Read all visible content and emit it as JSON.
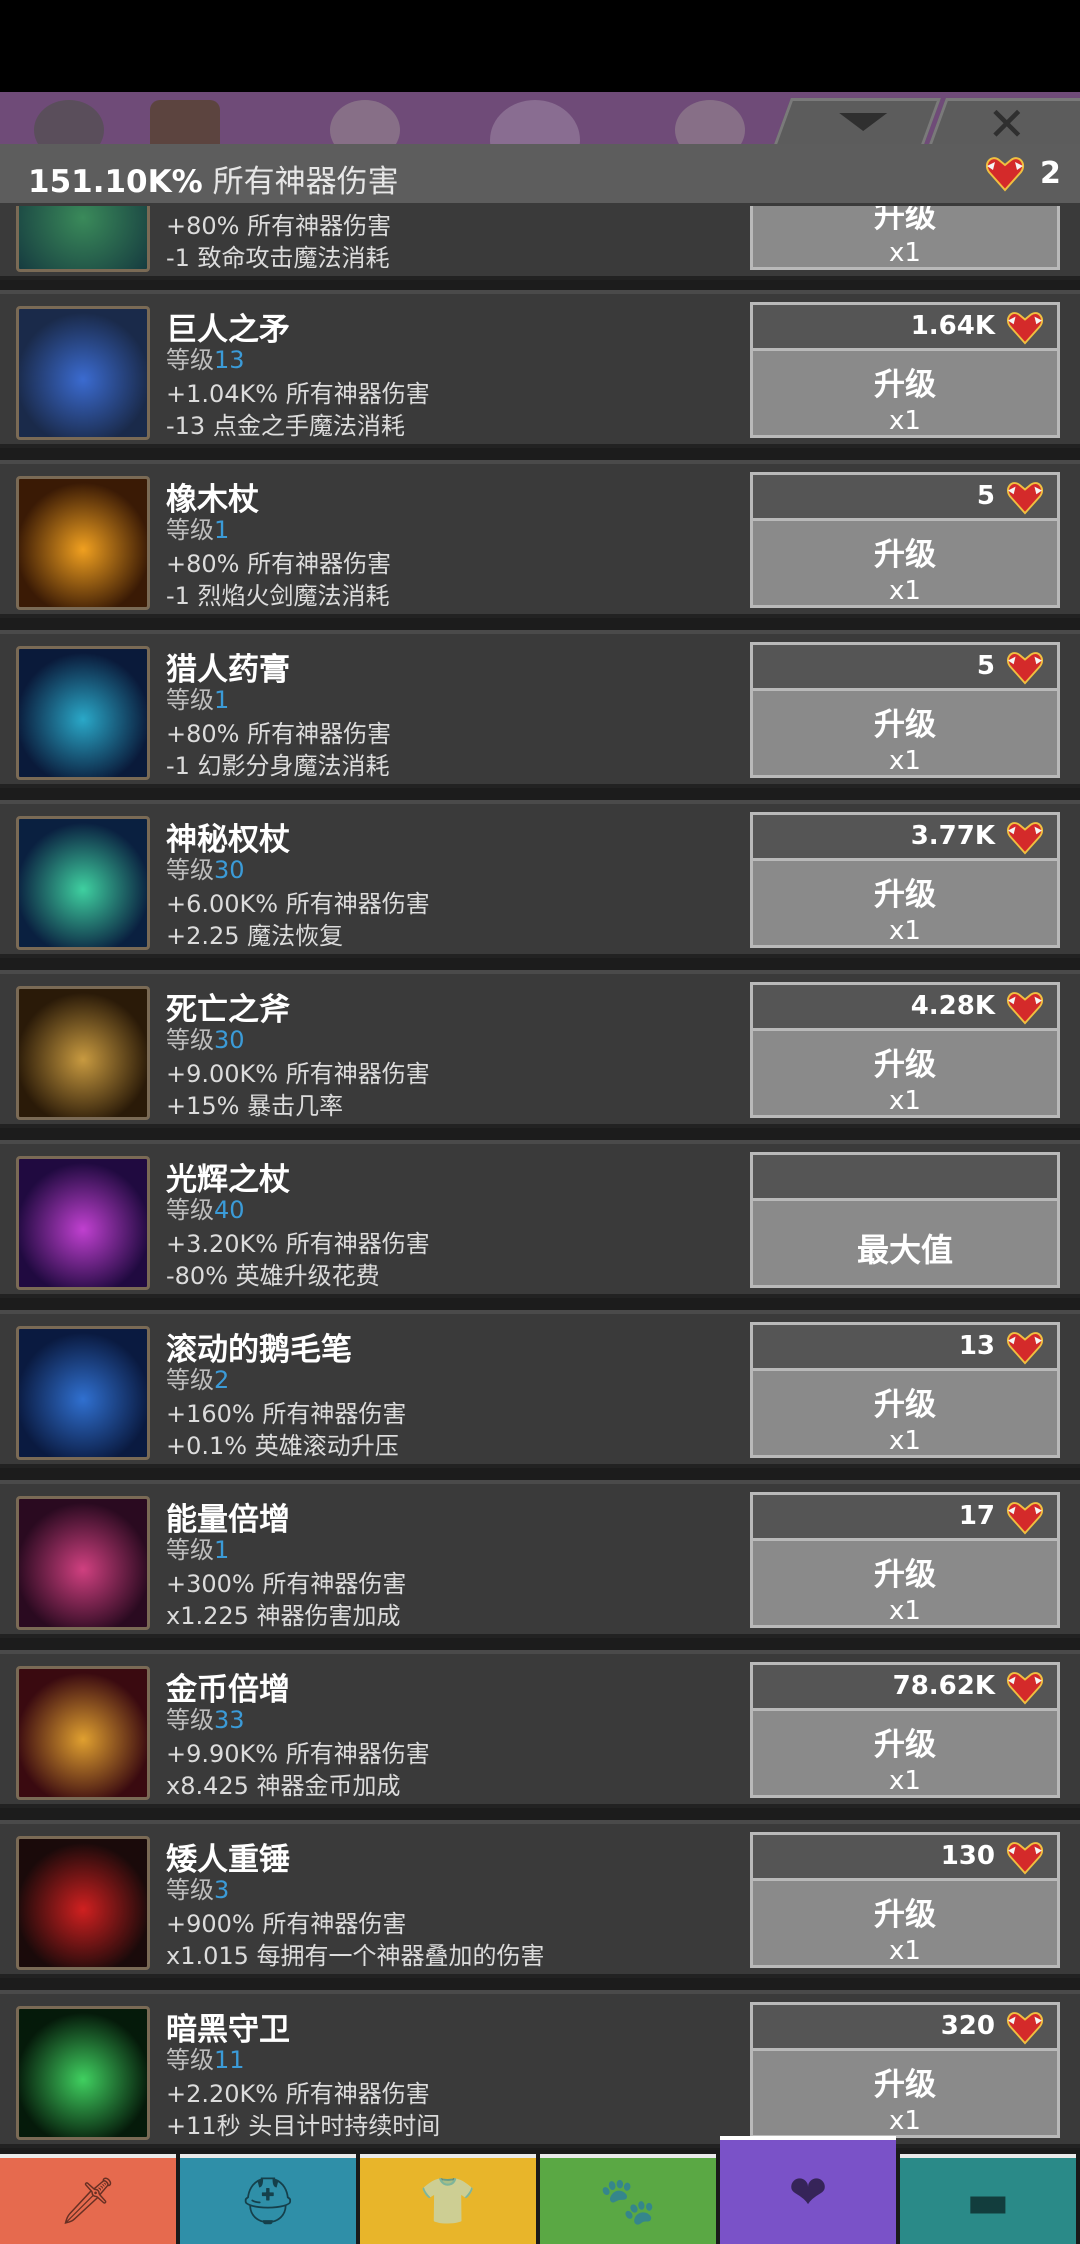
{
  "header": {
    "value": "151.10K%",
    "description": "所有神器伤害",
    "relic_count": "2"
  },
  "top_tabs": [
    "gear-icon",
    "crossed-swords-icon",
    "tab-3-icon",
    "tab-4-icon",
    "tab-5-icon"
  ],
  "controls": {
    "close_glyph": "✕"
  },
  "partial_row": {
    "eff1": "+80% 所有神器伤害",
    "eff2": "-1 致命攻击魔法消耗",
    "up_label": "升级",
    "multiplier": "x1"
  },
  "level_prefix": "等级",
  "artifacts": [
    {
      "name": "巨人之矛",
      "level": "13",
      "eff1": "+1.04K% 所有神器伤害",
      "eff2": "-13 点金之手魔法消耗",
      "cost": "1.64K",
      "action": "升级",
      "multiplier": "x1",
      "color_a": "#1a2a4a",
      "color_b": "#3b6bd0"
    },
    {
      "name": "橡木杖",
      "level": "1",
      "eff1": "+80% 所有神器伤害",
      "eff2": "-1 烈焰火剑魔法消耗",
      "cost": "5",
      "action": "升级",
      "multiplier": "x1",
      "color_a": "#3a1a05",
      "color_b": "#f0a020"
    },
    {
      "name": "猎人药膏",
      "level": "1",
      "eff1": "+80% 所有神器伤害",
      "eff2": "-1 幻影分身魔法消耗",
      "cost": "5",
      "action": "升级",
      "multiplier": "x1",
      "color_a": "#0a1a3a",
      "color_b": "#2aa8c8"
    },
    {
      "name": "神秘权杖",
      "level": "30",
      "eff1": "+6.00K% 所有神器伤害",
      "eff2": "+2.25 魔法恢复",
      "cost": "3.77K",
      "action": "升级",
      "multiplier": "x1",
      "color_a": "#0a2040",
      "color_b": "#3fd0a0"
    },
    {
      "name": "死亡之斧",
      "level": "30",
      "eff1": "+9.00K% 所有神器伤害",
      "eff2": "+15% 暴击几率",
      "cost": "4.28K",
      "action": "升级",
      "multiplier": "x1",
      "color_a": "#2a1a08",
      "color_b": "#c89a40"
    },
    {
      "name": "光辉之杖",
      "level": "40",
      "eff1": "+3.20K% 所有神器伤害",
      "eff2": "-80% 英雄升级花费",
      "cost": "",
      "action": "最大值",
      "multiplier": "",
      "color_a": "#200a40",
      "color_b": "#c040d0"
    },
    {
      "name": "滚动的鹅毛笔",
      "level": "2",
      "eff1": "+160% 所有神器伤害",
      "eff2": "+0.1% 英雄滚动升压",
      "cost": "13",
      "action": "升级",
      "multiplier": "x1",
      "color_a": "#0a1a40",
      "color_b": "#3070d0"
    },
    {
      "name": "能量倍增",
      "level": "1",
      "eff1": "+300% 所有神器伤害",
      "eff2": "x1.225 神器伤害加成",
      "cost": "17",
      "action": "升级",
      "multiplier": "x1",
      "color_a": "#2a0a20",
      "color_b": "#d04080"
    },
    {
      "name": "金币倍增",
      "level": "33",
      "eff1": "+9.90K% 所有神器伤害",
      "eff2": "x8.425 神器金币加成",
      "cost": "78.62K",
      "action": "升级",
      "multiplier": "x1",
      "color_a": "#3a0a10",
      "color_b": "#e0a030"
    },
    {
      "name": "矮人重锤",
      "level": "3",
      "eff1": "+900% 所有神器伤害",
      "eff2": "x1.015 每拥有一个神器叠加的伤害",
      "cost": "130",
      "action": "升级",
      "multiplier": "x1",
      "color_a": "#1a0a0a",
      "color_b": "#d02020"
    },
    {
      "name": "暗黑守卫",
      "level": "11",
      "eff1": "+2.20K% 所有神器伤害",
      "eff2": "+11秒 头目计时持续时间",
      "cost": "320",
      "action": "升级",
      "multiplier": "x1",
      "color_a": "#051a0a",
      "color_b": "#40d060"
    }
  ],
  "bottom_nav": [
    {
      "icon": "sword-icon",
      "glyph": "🗡",
      "color": "#e66a4e"
    },
    {
      "icon": "helmet-icon",
      "glyph": "⛑",
      "color": "#2f8fa8"
    },
    {
      "icon": "shirt-icon",
      "glyph": "👕",
      "color": "#e8b52a"
    },
    {
      "icon": "pet-icon",
      "glyph": "🐾",
      "color": "#5aa844"
    },
    {
      "icon": "winged-heart-icon",
      "glyph": "❤",
      "color": "#7a52c8",
      "active": true
    },
    {
      "icon": "chest-icon",
      "glyph": "▬",
      "color": "#2a8a88"
    }
  ]
}
